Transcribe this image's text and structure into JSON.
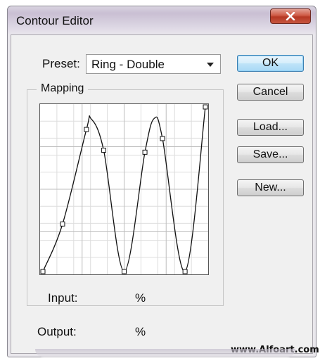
{
  "window": {
    "title": "Contour Editor"
  },
  "titlebar": {
    "close_label": "x"
  },
  "preset": {
    "label": "Preset:",
    "value": "Ring - Double"
  },
  "buttons": {
    "ok": "OK",
    "cancel": "Cancel",
    "load": "Load...",
    "save": "Save...",
    "new": "New..."
  },
  "mapping": {
    "legend": "Mapping",
    "curve_points": [
      [
        0,
        0
      ],
      [
        12.1,
        28.9
      ],
      [
        26.8,
        86.3
      ],
      [
        37.4,
        73.7
      ],
      [
        50,
        0
      ],
      [
        62.8,
        72.5
      ],
      [
        73.6,
        80.8
      ],
      [
        87.5,
        0
      ],
      [
        100,
        100
      ]
    ]
  },
  "fields": {
    "input_label": "Input:",
    "input_unit": "%",
    "output_label": "Output:",
    "output_unit": "%"
  },
  "watermark": "www.Alfoart.com"
}
